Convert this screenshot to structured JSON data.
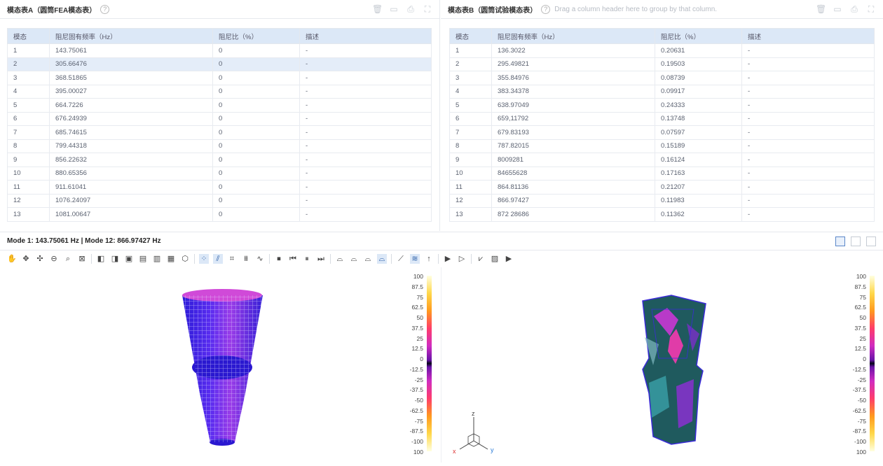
{
  "panel_a": {
    "title": "模态表A（圆筒FEA模态表）",
    "help": "?",
    "columns": [
      "模态",
      "阻尼固有频率（Hz）",
      "阻尼比（%）",
      "描述"
    ],
    "rows": [
      [
        "1",
        "143.75061",
        "0",
        "-"
      ],
      [
        "2",
        "305.66476",
        "0",
        "-"
      ],
      [
        "3",
        "368.51865",
        "0",
        "-"
      ],
      [
        "4",
        "395.00027",
        "0",
        "-"
      ],
      [
        "5",
        "664.7226",
        "0",
        "-"
      ],
      [
        "6",
        "676.24939",
        "0",
        "-"
      ],
      [
        "7",
        "685.74615",
        "0",
        "-"
      ],
      [
        "8",
        "799.44318",
        "0",
        "-"
      ],
      [
        "9",
        "856.22632",
        "0",
        "-"
      ],
      [
        "10",
        "880.65356",
        "0",
        "-"
      ],
      [
        "11",
        "911.61041",
        "0",
        "-"
      ],
      [
        "12",
        "1076.24097",
        "0",
        "-"
      ],
      [
        "13",
        "1081.00647",
        "0",
        "-"
      ]
    ]
  },
  "panel_b": {
    "title": "模态表B（圆筒试验模态表）",
    "help": "?",
    "hint": "Drag a column header here to group by that column.",
    "columns": [
      "模态",
      "阻尼固有频率（Hz）",
      "阻尼比（%）",
      "描述"
    ],
    "rows": [
      [
        "1",
        "136.3022",
        "0.20631",
        "-"
      ],
      [
        "2",
        "295.49821",
        "0.19503",
        "-"
      ],
      [
        "3",
        "355.84976",
        "0.08739",
        "-"
      ],
      [
        "4",
        "383.34378",
        "0.09917",
        "-"
      ],
      [
        "5",
        "638.97049",
        "0.24333",
        "-"
      ],
      [
        "6",
        "659,11792",
        "0.13748",
        "-"
      ],
      [
        "7",
        "679.83193",
        "0.07597",
        "-"
      ],
      [
        "8",
        "787.82015",
        "0.15189",
        "-"
      ],
      [
        "9",
        "8009281",
        "0.16124",
        "-"
      ],
      [
        "10",
        "84655628",
        "0.17163",
        "-"
      ],
      [
        "11",
        "864.81136",
        "0.21207",
        "-"
      ],
      [
        "12",
        "866.97427",
        "0.11983",
        "-"
      ],
      [
        "13",
        "872 28686",
        "0.11362",
        "-"
      ]
    ]
  },
  "mode_title": "Mode 1: 143.75061 Hz | Mode 12: 866.97427 Hz",
  "legend_labels": [
    "100",
    "87.5",
    "75",
    "62.5",
    "50",
    "37.5",
    "25",
    "12.5",
    "0",
    "-12.5",
    "-25",
    "-37.5",
    "-50",
    "-62.5",
    "-75",
    "-87.5",
    "-100",
    "100"
  ],
  "axes": {
    "z": "z",
    "x": "x",
    "y": "y"
  }
}
